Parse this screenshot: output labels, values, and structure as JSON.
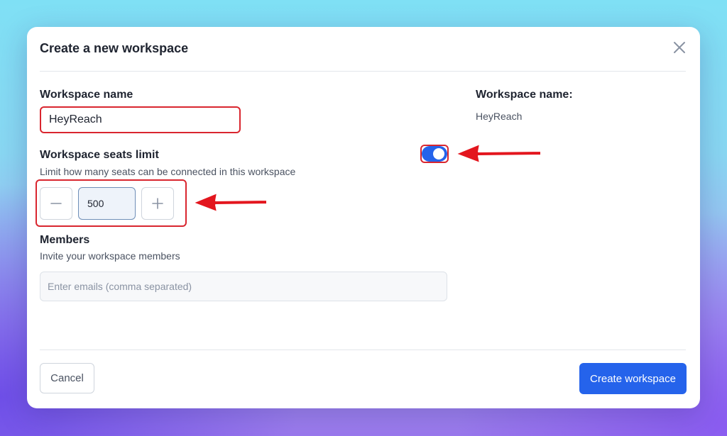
{
  "dialog": {
    "title": "Create a new workspace",
    "close_icon": "close-icon"
  },
  "workspace_name": {
    "label": "Workspace name",
    "value": "HeyReach"
  },
  "seats": {
    "label": "Workspace seats limit",
    "hint": "Limit how many seats can be connected in this workspace",
    "value": "500",
    "decrement_icon": "minus-icon",
    "increment_icon": "plus-icon",
    "toggle_on": true
  },
  "members": {
    "label": "Members",
    "hint": "Invite your workspace members",
    "placeholder": "Enter emails (comma separated)"
  },
  "preview": {
    "label": "Workspace name:",
    "value": "HeyReach"
  },
  "footer": {
    "cancel_label": "Cancel",
    "create_label": "Create workspace"
  },
  "colors": {
    "accent": "#2563eb",
    "highlight": "#d9262f"
  }
}
